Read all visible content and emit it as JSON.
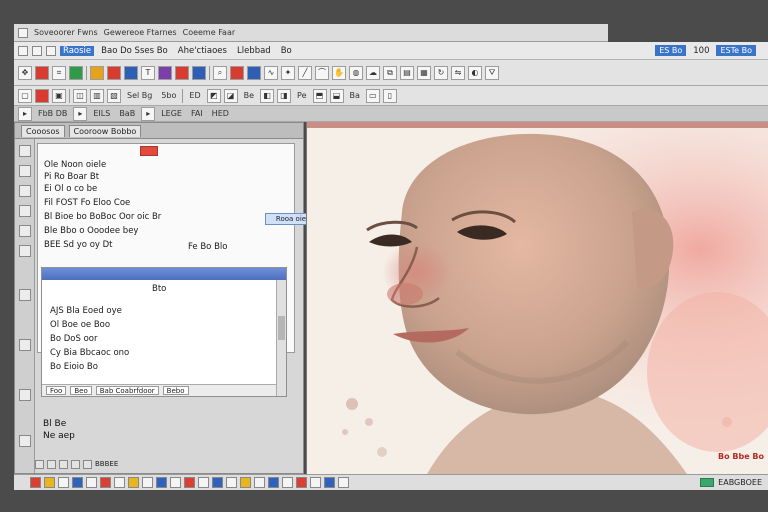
{
  "topstrip": [
    "Soveoorer Fwns",
    "Gewereoe Ftarnes",
    "Coeeme Faar"
  ],
  "menubar": {
    "items": [
      "Raosie",
      "Bao Do Sses Bo",
      "Ahe'ctiaoes",
      "Llebbad",
      "Bo"
    ],
    "right_label": "ES Bo",
    "right_value": "100",
    "right_label2": "ESTe Bo"
  },
  "toolbar2": {
    "labels": [
      "Sel Bg",
      "5bo",
      "ED",
      "Be",
      "Pe",
      "Ba"
    ]
  },
  "toolbar3": {
    "labels": [
      "FbB DB",
      "EILS",
      "BaB",
      "LEGE",
      "FAI",
      "HED"
    ]
  },
  "dock": {
    "tabs": [
      "Cooosos",
      "Cooroow Bobbo"
    ],
    "panel_rows": [
      "Ole Noon oiele",
      "Pi Ro Boar Bt",
      "Ei Ol o co be",
      "Fil FOST Fo Eloo Coe",
      "Bl Bioe bo BoBoc Oor oic Br",
      "Ble Bbo o Ooodee bey",
      "BEE Sd yo oy Dt"
    ],
    "float_button": "Rooa oie",
    "panel_side_text": "Fe Bo Blo",
    "subpanel_rows": [
      "Bto",
      "AJS Bla Eoed oye",
      "Ol Boe oe Boo",
      "Bo DoS oor",
      "Cy Bia Bbcaoc ono",
      "Bo Eioio Bo"
    ],
    "subpanel_status": [
      "Foo",
      "Beo",
      "Bab Coabrfdoor",
      "Bebo"
    ],
    "bottom_text": [
      "Bl Be",
      "Ne aep"
    ],
    "footer_label": "BBBEE"
  },
  "bottombar": {
    "right_text": "EABGBOEE",
    "watermark": "Bo Bbe Bo"
  },
  "colors": {
    "accent": "#3a74c8",
    "panel_bg": "#d7d7d7",
    "canvas_bg": "#f6efe8"
  }
}
